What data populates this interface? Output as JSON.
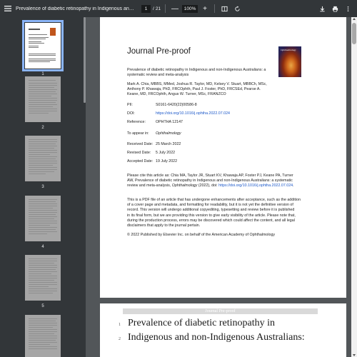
{
  "toolbar": {
    "title": "Prevalence of diabetic retinopathy in Indigenous and non-...",
    "current_page": "1",
    "separator": "/",
    "total_pages": "21",
    "zoom": "100%",
    "zoom_out": "—",
    "zoom_in": "+"
  },
  "sidebar": {
    "thumbnails": [
      {
        "num": "1",
        "selected": true
      },
      {
        "num": "2"
      },
      {
        "num": "3"
      },
      {
        "num": "4"
      },
      {
        "num": "5"
      },
      {
        "num": ""
      }
    ]
  },
  "page1": {
    "heading": "Journal Pre-proof",
    "cover_label": "Ophthalmology",
    "article_title": [
      "Prevalence of diabetic retinopathy in Indigenous and non-Indigenous Australians: a",
      "systematic review and meta-analysis"
    ],
    "authors": [
      "Mark A. Chia, MBBS, MMed, Joshua R. Taylor, MD, Kelsey V. Stuart, MBBCh, MSc,",
      "Anthony P. Khawaja, PhD, FRCOphth, Paul J. Foster, PhD, FRCSEd, Pearse A.",
      "Keane, MD, FRCOphth, Angus W. Turner, MSc, FRANZCO"
    ],
    "pii_label": "PII:",
    "pii_value": "S0161-6420(22)00586-8",
    "doi_label": "DOI:",
    "doi_value": "https://doi.org/10.1016/j.ophtha.2022.07.024",
    "ref_label": "Reference:",
    "ref_value": "OPHTHA 12147",
    "appear_label": "To appear in:",
    "appear_value": "Ophthalmology",
    "received_label": "Received Date:",
    "received_value": "25 March 2022",
    "revised_label": "Revised Date:",
    "revised_value": "5 July 2022",
    "accepted_label": "Accepted Date:",
    "accepted_value": "19 July 2022",
    "cite_line1": "Please cite this article as: Chia MA, Taylor JR, Stuart KV, Khawaja AP, Foster PJ, Keane PA, Turner",
    "cite_line2": "AW, Prevalence of diabetic retinopathy in Indigenous and non-Indigenous Australians: a systematic",
    "cite_line3_pre": "review and meta-analysis,",
    "cite_line3_journal": "Ophthalmology",
    "cite_line3_mid": "(2022), doi:",
    "cite_line3_link": "https://doi.org/10.1016/j.ophtha.2022.07.024",
    "cite_line3_end": ".",
    "notice": [
      "This is a PDF file of an article that has undergone enhancements after acceptance, such as the addition",
      "of a cover page and metadata, and formatting for readability, but it is not yet the definitive version of",
      "record. This version will undergo additional copyediting, typesetting and review before it is published",
      "in its final form, but we are providing this version to give early visibility of the article. Please note that,",
      "during the production process, errors may be discovered which could affect the content, and all legal",
      "disclaimers that apply to the journal pertain."
    ],
    "copyright": "© 2022 Published by Elsevier Inc. on behalf of the American Academy of Ophthalmology"
  },
  "page2": {
    "header": "Journal Pre-proof",
    "lines": [
      {
        "num": "1",
        "text": "Prevalence of diabetic retinopathy in"
      },
      {
        "num": "2",
        "text": "Indigenous and non-Indigenous Australians:"
      }
    ]
  },
  "colors": {
    "toolbar_bg": "#323639",
    "viewer_bg": "#525659",
    "link": "#1a57c9",
    "thumb_selected": "#8ab4f8"
  },
  "icons": [
    "menu-icon",
    "fit-page-icon",
    "rotate-icon",
    "download-icon",
    "print-icon",
    "more-vert-icon"
  ]
}
